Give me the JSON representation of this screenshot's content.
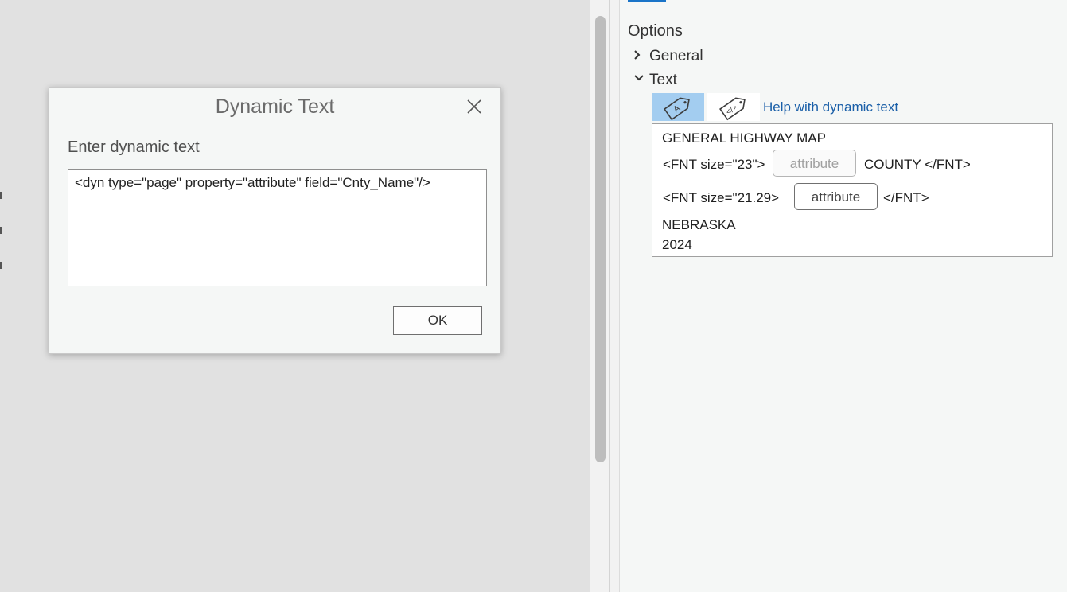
{
  "dialog": {
    "title": "Dynamic Text",
    "prompt_label": "Enter dynamic text",
    "input_value": "<dyn type=\"page\" property=\"attribute\" field=\"Cnty_Name\"/>",
    "ok_label": "OK"
  },
  "options": {
    "title": "Options",
    "sections": [
      {
        "label": "General",
        "expanded": false
      },
      {
        "label": "Text",
        "expanded": true
      }
    ],
    "toolbar": {
      "buttons": [
        {
          "icon": "tag-a-icon",
          "selected": true
        },
        {
          "icon": "tag-code-icon",
          "selected": false
        }
      ],
      "help_link": "Help with dynamic text"
    },
    "text_content": {
      "line1": "GENERAL HIGHWAY MAP",
      "line2_prefix": "<FNT size=\"23\">",
      "line2_attr": "attribute",
      "line2_suffix": "COUNTY </FNT>",
      "line3_prefix": "<FNT size=\"21.29>",
      "line3_attr": "attribute",
      "line3_suffix": "</FNT>",
      "line4": "NEBRASKA",
      "line5": "2024"
    }
  },
  "colors": {
    "accent": "#1a74c8",
    "selected_tool": "#a3cdf0",
    "link": "#1a5fa8"
  }
}
